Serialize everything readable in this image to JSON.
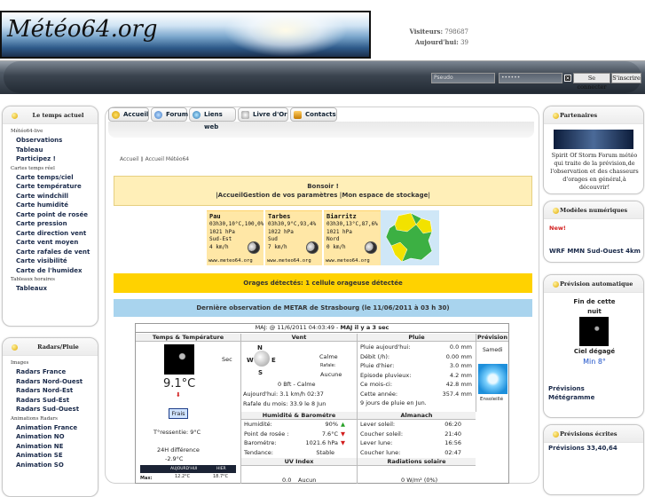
{
  "header": {
    "logo_text": "Météo64.org",
    "visitors_label": "Visiteurs:",
    "visitors_value": "798687",
    "today_label": "Aujourd'hui:",
    "today_value": "39"
  },
  "login": {
    "user_value": "Pseudo",
    "pass_value": "••••••",
    "close_glyph": "✕",
    "connect_label": "Se connecter",
    "register_label": "S'inscrire"
  },
  "left": {
    "box1_title": "Le temps actuel",
    "sections": [
      {
        "title": "Météo64-live",
        "items": [
          "Observations",
          "Tableau",
          "Participez !"
        ]
      },
      {
        "title": "Cartes temps réel",
        "items": [
          "Carte temps/ciel",
          "Carte température",
          "Carte windchill",
          "Carte humidité",
          "Carte point de rosée",
          "Carte pression",
          "Carte direction vent",
          "Carte vent moyen",
          "Carte rafales de vent",
          "Carte visibilité",
          "Carte de l'humidex"
        ]
      },
      {
        "title": "Tableaux horaires",
        "items": [
          "Tableaux"
        ]
      }
    ],
    "box2_title": "Radars/Pluie",
    "sections2": [
      {
        "title": "Images",
        "items": [
          "Radars France",
          "Radars Nord-Ouest",
          "Radars Nord-Est",
          "Radars Sud-Est",
          "Radars Sud-Ouest"
        ]
      },
      {
        "title": "Animations Radars",
        "items": [
          "Animation France",
          "Animation NO",
          "Animation NE",
          "Animation SE",
          "Animation SO"
        ]
      }
    ]
  },
  "tabs": [
    "Accueil",
    "Forum",
    "Liens web",
    "Livre d'Or",
    "Contacts"
  ],
  "breadcrumb": "Accueil  ⟫  Accueil Météo64",
  "welcome": {
    "line1": "Bonsoir !",
    "line2": "|AccueilGestion de vos paramètres |Mon espace de stockage|"
  },
  "cities": [
    {
      "name": "Pau",
      "l1": "03h30,10°C,100,0%",
      "l2": "1021 hPa",
      "l3": "Sud-Est",
      "l4": "4 km/h",
      "stamp": "www.meteo64.org"
    },
    {
      "name": "Tarbes",
      "l1": "03h30,9°C,93,4%",
      "l2": "1022 hPa",
      "l3": "Sud",
      "l4": "7 km/h",
      "stamp": "www.meteo64.org"
    },
    {
      "name": "Biarritz",
      "l1": "03h30,13°C,87,6%",
      "l2": "1021 hPa",
      "l3": "Nord",
      "l4": "0 km/h",
      "stamp": "www.meteo64.org"
    }
  ],
  "orages": "Orages détectés: 1 cellule orageuse détectée",
  "metar": "Dernière observation de METAR de Strasbourg (le 11/06/2011 à 03 h 30)",
  "table": {
    "maj": "MAJ: @ 11/6/2011 04:03:49 - ",
    "maj_bold": "MAJ il y a 3 sec",
    "h_temp": "Temps & Température",
    "h_vent": "Vent",
    "h_pluie": "Pluie",
    "h_prev": "Prévision",
    "sky": "Sec",
    "temp": "9.1°C",
    "temp_arrow": "⬇",
    "frais": "Frais",
    "ressentie": "T°ressentie: 9°C",
    "diff_label": "24H différence",
    "diff_value": "-2.9°C",
    "today_head": "AUJOURD'HUI",
    "hier_head": "HIER",
    "max_label": "Max:",
    "max_today": "12.2°C",
    "max_hier": "18.7°C",
    "compass": [
      "N",
      "W",
      "E",
      "S"
    ],
    "calme": "Calme",
    "rafale_label": "Rafale:",
    "rafale_value": "Aucune",
    "bft": "0 Bft - Calme",
    "today_wind": "Aujourd'hui: 3.1 km/h 02:37",
    "month_gust": "Rafale du mois: 33.9 le 8 Jun",
    "pluie_rows": [
      [
        "Pluie aujourd'hui:",
        "0.0 mm"
      ],
      [
        "Débit (/h):",
        "0.00 mm"
      ],
      [
        "Pluie d'hier:",
        "3.0 mm"
      ],
      [
        "Episode pluvieux:",
        "4.2 mm"
      ],
      [
        "Ce mois-ci:",
        "42.8 mm"
      ],
      [
        "Cette année:",
        "357.4 mm"
      ]
    ],
    "pluie_days": "9 jours de pluie en Jun.",
    "prev1": "Samedi",
    "prev2": "Ensoleillé",
    "h_hum": "Humidité & Barométre",
    "hum_rows": [
      [
        "Humidité:",
        "90%"
      ],
      [
        "Point de rosée :",
        "7.6°C"
      ],
      [
        "Barométre:",
        "1021.6 hPa"
      ],
      [
        "Tendance:",
        "Stable"
      ]
    ],
    "h_alm": "Almanach",
    "alm_rows": [
      [
        "Lever soleil:",
        "06:20"
      ],
      [
        "Coucher soleil:",
        "21:40"
      ],
      [
        "Lever lune:",
        "16:56"
      ],
      [
        "Coucher lune:",
        "02:47"
      ]
    ],
    "h_uv": "UV Index",
    "uv": "0.0",
    "uv_text": "Aucun",
    "h_rad": "Radiations solaire",
    "rad": "0 W/m² (0%)"
  },
  "right": {
    "partners_title": "Partenaires",
    "partners_text": "Spirit Of Storm Forum météo qui traite de la prévision,de l'observation et des chasseurs d'orages en général,à découvrir!",
    "models_title": "Modèles numériques",
    "new": "New!",
    "wrf": "WRF MMN Sud-Ouest 4km",
    "auto_title": "Prévision automatique",
    "auto_line1": "Fin de cette",
    "auto_line2": "nuit",
    "auto_sky": "Ciel dégagé",
    "auto_min": "Min 8°",
    "auto_link1": "Prévisions",
    "auto_link2": "Métégramme",
    "written_title": "Prévisions écrites",
    "written_link": "Prévisions 33,40,64"
  },
  "colors": {
    "accent_blue": "#1b50c8",
    "orages_yellow": "#ffd200",
    "metar_blue": "#a9d4ee",
    "welcome_bg": "#ffefb8",
    "arrow_red": "#d21e1e",
    "arrow_green": "#28a028"
  }
}
